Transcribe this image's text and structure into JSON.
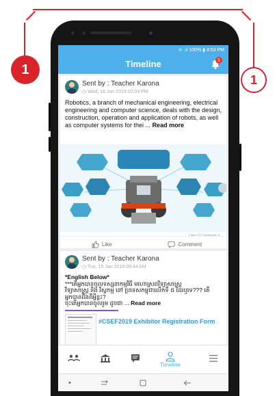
{
  "callouts": {
    "left": "1",
    "right": "1"
  },
  "status_bar": {
    "text": "ᯤ .ıl 100% ▮ 4:53 PM"
  },
  "app_bar": {
    "title": "Timeline",
    "notification_count": "1"
  },
  "posts": [
    {
      "sender": "Sent by : Teacher Karona",
      "timestamp": "Wed, 16 Jan 2019 02:04 PM",
      "text": "Robotics, a branch of mechanical engineering, electrical engineering and computer science, deals with the design, construction, operation and application of robots, as well as computer systems for thei ...",
      "read_more": "Read more",
      "meta": "Likes 0 Comments 0",
      "like_label": "Like",
      "comment_label": "Comment"
    },
    {
      "sender": "Sent by : Teacher Karona",
      "timestamp": "Tue, 15 Jan 2019 09:44 AM",
      "lines": [
        "*English Below*",
        "***តើអ្នកបានចូលទស្សនាកម្មវិធី មហោស្រពវិទ្យាសាស្ត្រ",
        "វិទ្យាសាស្ត្រ និង វិស្វកម្ម នៅ ប្រទេសកម្ពុជាលើកទី ៥ ដែរឬទេ??? តើ",
        "អ្នកបានដឹងពីអ្វីខ្លះ?",
        "ចុះតើអ្នកបានចូលរួម ដូចជា ..."
      ],
      "read_more": "Read more",
      "banner_title": "#CSEF2019 Exhibitor Registration Form"
    }
  ],
  "nav": {
    "timeline_label": "Timeline"
  },
  "colors": {
    "primary": "#4db0ea",
    "callout": "#d8232a",
    "banner_text": "#2e9ad8"
  },
  "icons": [
    "wifi-icon",
    "signal-icon",
    "battery-icon",
    "bell-icon",
    "like-icon",
    "comment-icon",
    "group-icon",
    "school-icon",
    "chat-icon",
    "timeline-icon",
    "menu-icon",
    "recent-apps-icon",
    "home-icon",
    "back-icon"
  ]
}
